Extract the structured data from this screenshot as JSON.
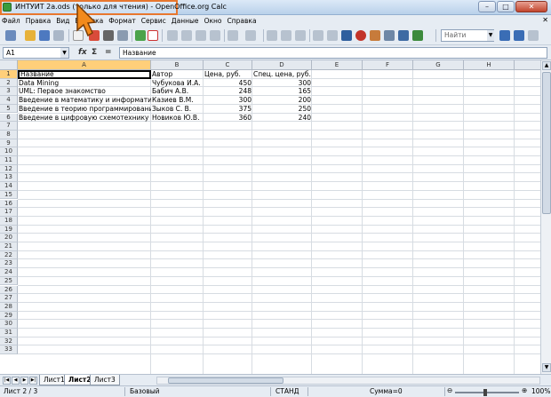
{
  "window": {
    "title": "ИНТУИТ 2a.ods (только для чтения) - OpenOffice.org Calc",
    "buttons": {
      "minimize": "–",
      "maximize": "□",
      "close": "✕"
    }
  },
  "menu": {
    "items": [
      "Файл",
      "Правка",
      "Вид",
      "Вставка",
      "Формат",
      "Сервис",
      "Данные",
      "Окно",
      "Справка"
    ],
    "close_glyph": "✕"
  },
  "toolbar": {
    "search_placeholder": "Найти",
    "colors": {
      "accent": "#e8772e"
    }
  },
  "formula_bar": {
    "name_box": "A1",
    "fx": "fx",
    "sigma": "Σ",
    "equals": "=",
    "content": "Название"
  },
  "sheet": {
    "columns": [
      "A",
      "B",
      "C",
      "D",
      "E",
      "F",
      "G",
      "H",
      "I"
    ],
    "row_numbers": [
      "1",
      "2",
      "3",
      "4",
      "5",
      "6",
      "7",
      "8",
      "9",
      "10",
      "11",
      "12",
      "13",
      "14",
      "15",
      "16",
      "17",
      "18",
      "19",
      "20",
      "21",
      "22",
      "23",
      "24",
      "25",
      "26",
      "27",
      "28",
      "29",
      "30",
      "31",
      "32",
      "33"
    ],
    "selected_cell": "A1",
    "rows": [
      [
        "Название",
        "Автор",
        "Цена, руб.",
        "Спец. цена, руб."
      ],
      [
        "Data Mining",
        "Чубукова И.А.",
        "450",
        "300"
      ],
      [
        "UML: Первое знакомство",
        "Бабич А.В.",
        "248",
        "165"
      ],
      [
        "Введение в математику и информатику",
        "Казиев В.М.",
        "300",
        "200"
      ],
      [
        "Введение в теорию программирования",
        "Зыков С. В.",
        "375",
        "250"
      ],
      [
        "Введение в цифровую схемотехнику",
        "Новиков Ю.В.",
        "360",
        "240"
      ]
    ]
  },
  "tabs": {
    "items": [
      "Лист1",
      "Лист2",
      "Лист3"
    ],
    "active": "Лист2"
  },
  "status": {
    "sheet": "Лист 2 / 3",
    "style": "Базовый",
    "mode": "СТАНД",
    "sum": "Сумма=0",
    "zoom": "100%",
    "minus": "⊖",
    "plus": "⊕"
  }
}
